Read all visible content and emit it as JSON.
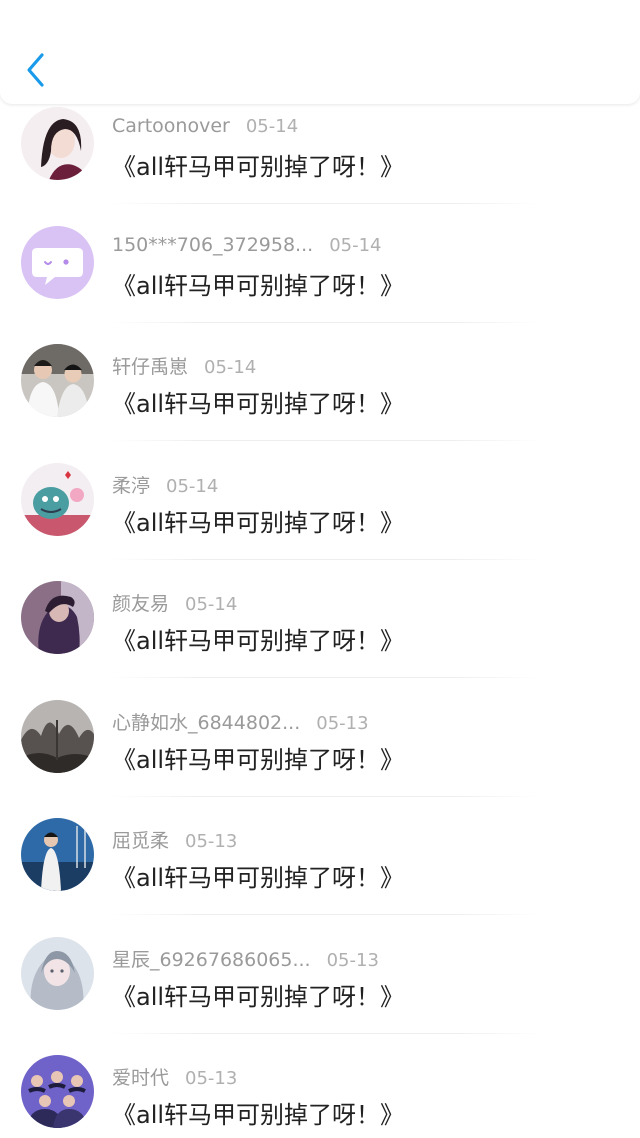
{
  "colors": {
    "accent": "#1a9bea",
    "username": "#9a9a9a",
    "text": "#222222"
  },
  "header": {
    "back_icon": "chevron-left-icon"
  },
  "items": [
    {
      "username": "Cartoonover",
      "date": "05-14",
      "title": "《all轩马甲可别掉了呀！》"
    },
    {
      "username": "150***706_372958...",
      "date": "05-14",
      "title": "《all轩马甲可别掉了呀！》"
    },
    {
      "username": "轩仔禹崽",
      "date": "05-14",
      "title": "《all轩马甲可别掉了呀！》"
    },
    {
      "username": "柔渟",
      "date": "05-14",
      "title": "《all轩马甲可别掉了呀！》"
    },
    {
      "username": "颜友易",
      "date": "05-14",
      "title": "《all轩马甲可别掉了呀！》"
    },
    {
      "username": "心静如水_6844802...",
      "date": "05-13",
      "title": "《all轩马甲可别掉了呀！》"
    },
    {
      "username": "屈觅柔",
      "date": "05-13",
      "title": "《all轩马甲可别掉了呀！》"
    },
    {
      "username": "星辰_69267686065...",
      "date": "05-13",
      "title": "《all轩马甲可别掉了呀！》"
    },
    {
      "username": "爱时代",
      "date": "05-13",
      "title": "《all轩马甲可别掉了呀！》"
    }
  ]
}
